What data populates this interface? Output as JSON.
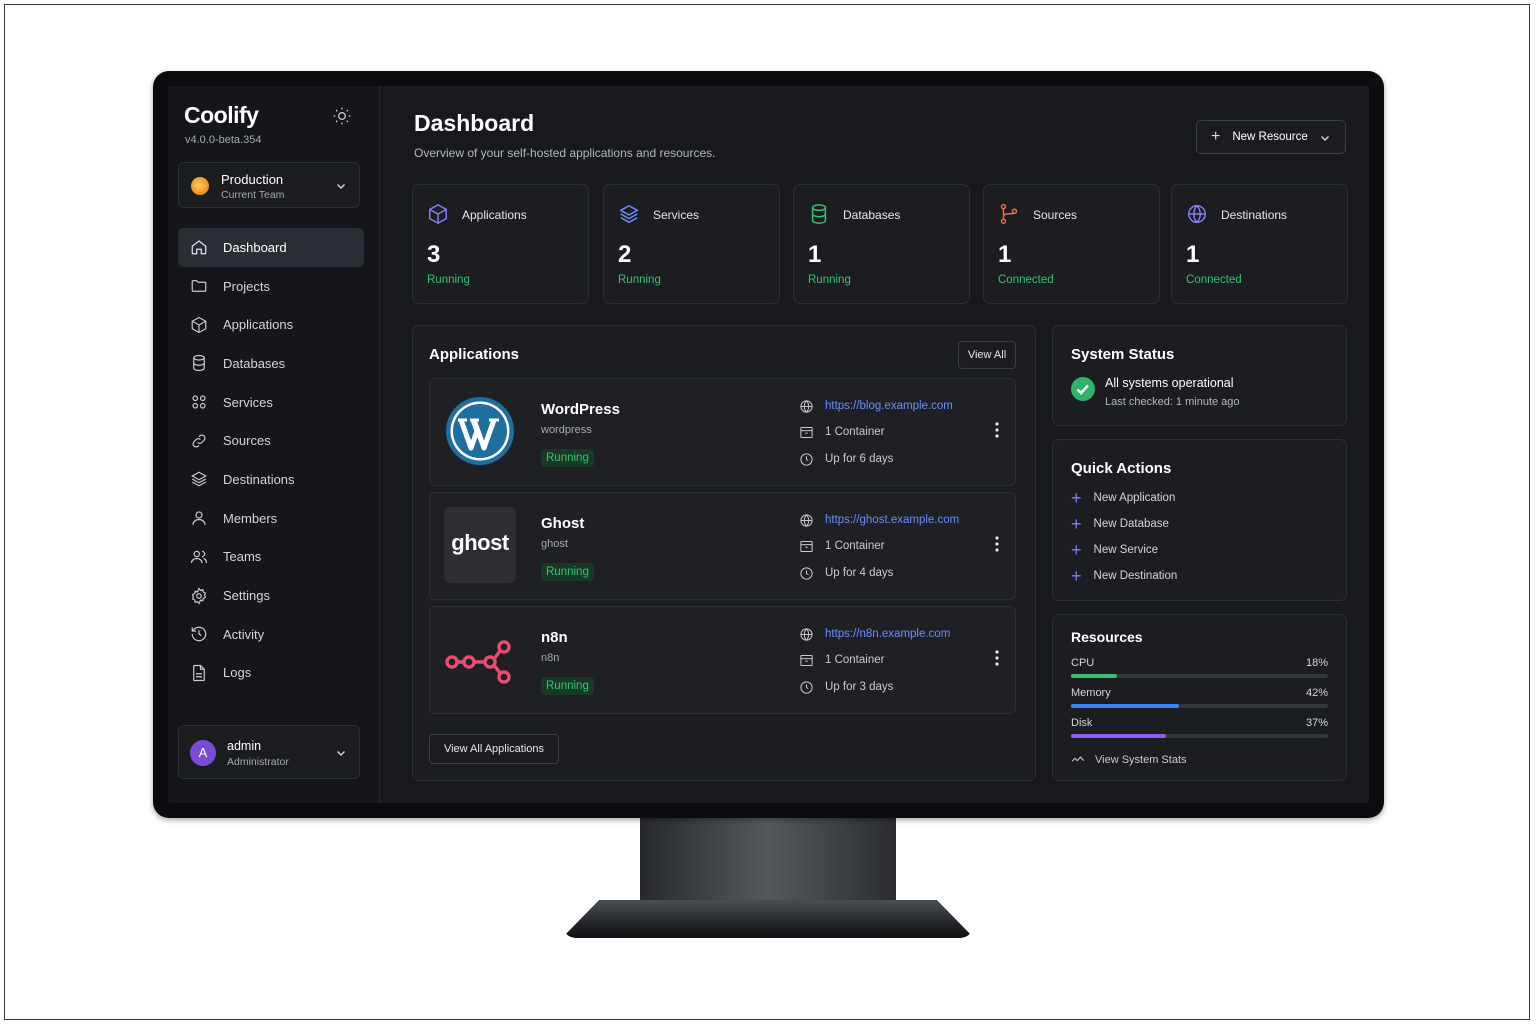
{
  "app": {
    "name": "Coolify",
    "version": "v4.0.0-beta.354"
  },
  "team": {
    "name": "Production",
    "label": "Current Team"
  },
  "nav": [
    {
      "label": "Dashboard",
      "icon": "home-icon",
      "active": true
    },
    {
      "label": "Projects",
      "icon": "folder-icon"
    },
    {
      "label": "Applications",
      "icon": "box-icon"
    },
    {
      "label": "Databases",
      "icon": "database-icon"
    },
    {
      "label": "Services",
      "icon": "grid-icon"
    },
    {
      "label": "Sources",
      "icon": "link-icon"
    },
    {
      "label": "Destinations",
      "icon": "layers-icon"
    },
    {
      "label": "Members",
      "icon": "user-icon"
    },
    {
      "label": "Teams",
      "icon": "users-icon"
    },
    {
      "label": "Settings",
      "icon": "gear-icon"
    },
    {
      "label": "Activity",
      "icon": "history-icon"
    },
    {
      "label": "Logs",
      "icon": "file-icon"
    }
  ],
  "user": {
    "initial": "A",
    "name": "admin",
    "role": "Administrator"
  },
  "header": {
    "title": "Dashboard",
    "subtitle": "Overview of your self-hosted applications and resources.",
    "new_resource_label": "New Resource"
  },
  "stats": [
    {
      "label": "Applications",
      "value": "3",
      "status": "Running",
      "icon": "box-icon",
      "color": "#8b7cf6"
    },
    {
      "label": "Services",
      "value": "2",
      "status": "Running",
      "icon": "stack-icon",
      "color": "#6f8cff"
    },
    {
      "label": "Databases",
      "value": "1",
      "status": "Running",
      "icon": "database-icon",
      "color": "#37c074"
    },
    {
      "label": "Sources",
      "value": "1",
      "status": "Connected",
      "icon": "git-branch-icon",
      "color": "#f06a4a"
    },
    {
      "label": "Destinations",
      "value": "1",
      "status": "Connected",
      "icon": "globe-icon",
      "color": "#8b7cf6"
    }
  ],
  "applications_panel": {
    "title": "Applications",
    "view_all_label": "View All",
    "view_all_apps_label": "View All Applications",
    "items": [
      {
        "name": "WordPress",
        "slug": "wordpress",
        "status": "Running",
        "url": "https://blog.example.com",
        "containers": "1 Container",
        "uptime": "Up for 6 days",
        "logo": "wordpress-logo"
      },
      {
        "name": "Ghost",
        "slug": "ghost",
        "status": "Running",
        "url": "https://ghost.example.com",
        "containers": "1 Container",
        "uptime": "Up for 4 days",
        "logo": "ghost-logo",
        "logo_text": "ghost"
      },
      {
        "name": "n8n",
        "slug": "n8n",
        "status": "Running",
        "url": "https://n8n.example.com",
        "containers": "1 Container",
        "uptime": "Up for 3 days",
        "logo": "n8n-logo"
      }
    ]
  },
  "system_status": {
    "title": "System Status",
    "message": "All systems operational",
    "checked": "Last checked: 1 minute ago"
  },
  "quick_actions": {
    "title": "Quick Actions",
    "items": [
      "New Application",
      "New Database",
      "New Service",
      "New Destination"
    ]
  },
  "resources": {
    "title": "Resources",
    "items": [
      {
        "label": "CPU",
        "value": "18%",
        "percent": 18,
        "color": "#37c074"
      },
      {
        "label": "Memory",
        "value": "42%",
        "percent": 42,
        "color": "#3b82f6"
      },
      {
        "label": "Disk",
        "value": "37%",
        "percent": 37,
        "color": "#8b5cf6"
      }
    ],
    "link_label": "View System Stats"
  }
}
